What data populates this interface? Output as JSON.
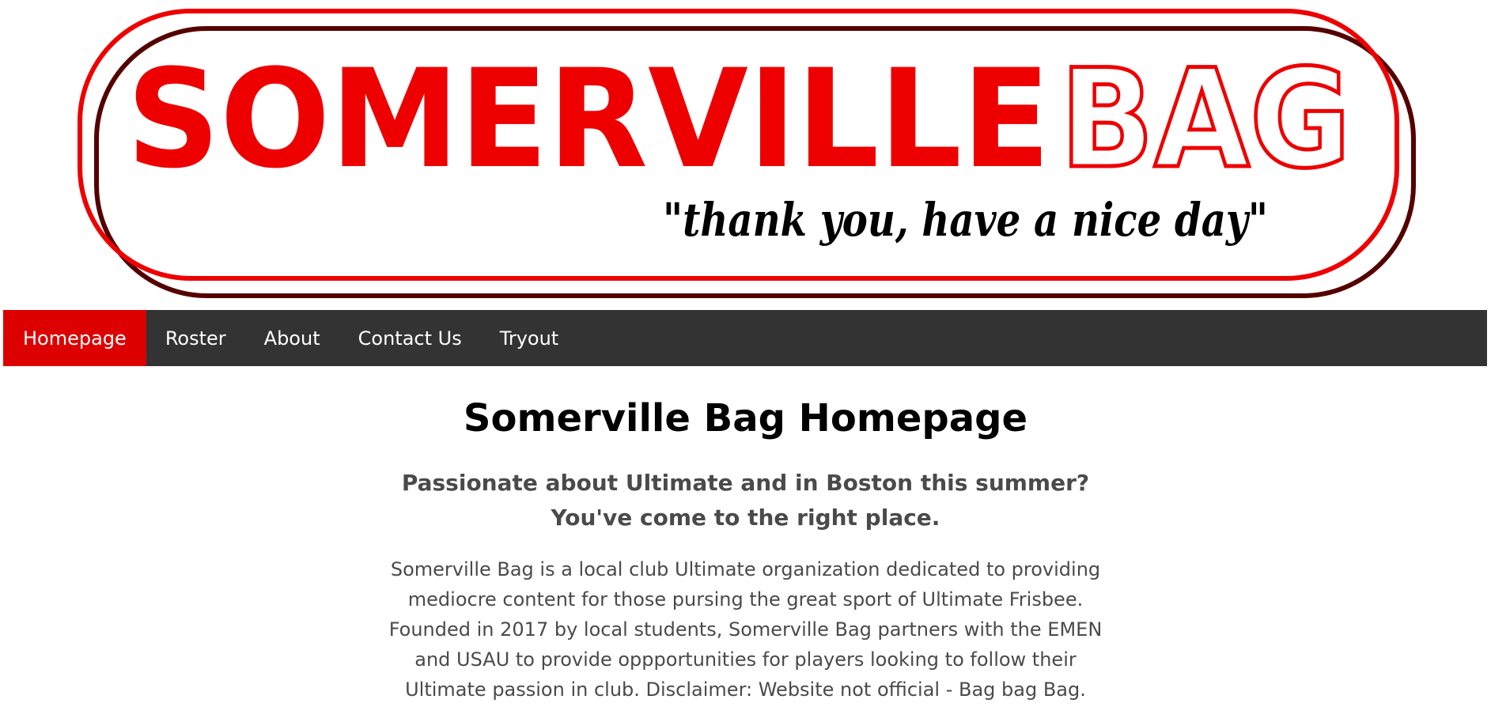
{
  "banner": {
    "logo_word_solid": "SOMERVILLE",
    "logo_word_outline": "BAG",
    "tagline": "\"thank you, have a nice day\"",
    "colors": {
      "red": "#ee0000",
      "dark_red": "#550000",
      "tagline": "#000000"
    }
  },
  "nav": {
    "items": [
      {
        "label": "Homepage",
        "active": true
      },
      {
        "label": "Roster",
        "active": false
      },
      {
        "label": "About",
        "active": false
      },
      {
        "label": "Contact Us",
        "active": false
      },
      {
        "label": "Tryout",
        "active": false
      }
    ],
    "colors": {
      "bar": "#333333",
      "active": "#dd0000",
      "text": "#ffffff"
    }
  },
  "main": {
    "title": "Somerville Bag Homepage",
    "subtitle_line1": "Passionate about Ultimate and in Boston this summer?",
    "subtitle_line2": "You've come to the right place.",
    "intro": "Somerville Bag is a local club Ultimate organization dedicated to providing mediocre content for those pursing the great sport of Ultimate Frisbee. Founded in 2017 by local students, Somerville Bag partners with the EMEN and USAU to provide oppportunities for players looking to follow their Ultimate passion in club. Disclaimer: Website not official - Bag bag Bag."
  }
}
